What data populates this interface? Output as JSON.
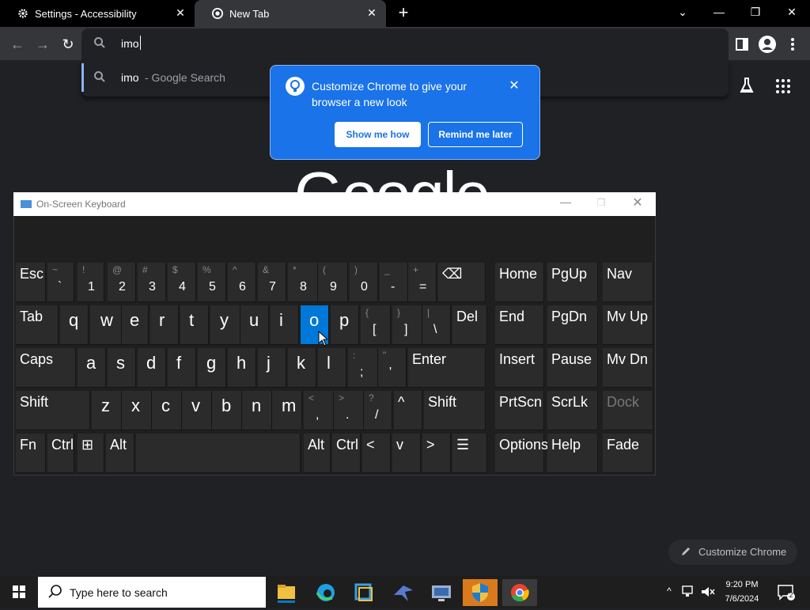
{
  "tabs": [
    {
      "title": "Settings - Accessibility",
      "icon": "gear-icon"
    },
    {
      "title": "New Tab",
      "icon": "chrome-icon"
    }
  ],
  "window_controls": {
    "dropdown": "⌄",
    "minimize": "—",
    "maximize": "❐",
    "close": "✕"
  },
  "omnibox": {
    "text": "imo"
  },
  "suggestion": {
    "query": "imo",
    "rest": " - Google Search"
  },
  "promo": {
    "text": "Customize Chrome to give your browser a new look",
    "show_label": "Show me how",
    "remind_label": "Remind me later"
  },
  "google_logo": "Google",
  "osk": {
    "title": "On-Screen Keyboard",
    "rows": [
      [
        {
          "label": "Esc",
          "kind": "lbl"
        },
        {
          "shift": "~",
          "main": "`"
        },
        {
          "shift": "!",
          "main": "1"
        },
        {
          "shift": "@",
          "main": "2"
        },
        {
          "shift": "#",
          "main": "3"
        },
        {
          "shift": "$",
          "main": "4"
        },
        {
          "shift": "%",
          "main": "5"
        },
        {
          "shift": "^",
          "main": "6"
        },
        {
          "shift": "&",
          "main": "7"
        },
        {
          "shift": "*",
          "main": "8"
        },
        {
          "shift": "(",
          "main": "9"
        },
        {
          "shift": ")",
          "main": "0"
        },
        {
          "shift": "_",
          "main": "-"
        },
        {
          "shift": "+",
          "main": "="
        },
        {
          "label": "⌫",
          "kind": "lbl"
        },
        {
          "label": "Home",
          "kind": "lbl"
        },
        {
          "label": "PgUp",
          "kind": "lbl"
        },
        {
          "label": "Nav",
          "kind": "lbl"
        }
      ],
      [
        {
          "label": "Tab",
          "kind": "lbl"
        },
        {
          "main": "q"
        },
        {
          "main": "w"
        },
        {
          "main": "e"
        },
        {
          "main": "r"
        },
        {
          "main": "t"
        },
        {
          "main": "y"
        },
        {
          "main": "u"
        },
        {
          "main": "i"
        },
        {
          "main": "o",
          "selected": true
        },
        {
          "main": "p"
        },
        {
          "shift": "{",
          "main": "["
        },
        {
          "shift": "}",
          "main": "]"
        },
        {
          "shift": "|",
          "main": "\\"
        },
        {
          "label": "Del",
          "kind": "lbl"
        },
        {
          "label": "End",
          "kind": "lbl"
        },
        {
          "label": "PgDn",
          "kind": "lbl"
        },
        {
          "label": "Mv Up",
          "kind": "lbl"
        }
      ],
      [
        {
          "label": "Caps",
          "kind": "lbl"
        },
        {
          "main": "a"
        },
        {
          "main": "s"
        },
        {
          "main": "d"
        },
        {
          "main": "f"
        },
        {
          "main": "g"
        },
        {
          "main": "h"
        },
        {
          "main": "j"
        },
        {
          "main": "k"
        },
        {
          "main": "l"
        },
        {
          "shift": ":",
          "main": ";"
        },
        {
          "shift": "\"",
          "main": "'"
        },
        {
          "label": "Enter",
          "kind": "lbl"
        },
        {
          "label": "Insert",
          "kind": "lbl"
        },
        {
          "label": "Pause",
          "kind": "lbl"
        },
        {
          "label": "Mv Dn",
          "kind": "lbl"
        }
      ],
      [
        {
          "label": "Shift",
          "kind": "lbl"
        },
        {
          "main": "z"
        },
        {
          "main": "x"
        },
        {
          "main": "c"
        },
        {
          "main": "v"
        },
        {
          "main": "b"
        },
        {
          "main": "n"
        },
        {
          "main": "m"
        },
        {
          "shift": "<",
          "main": ","
        },
        {
          "shift": ">",
          "main": "."
        },
        {
          "shift": "?",
          "main": "/"
        },
        {
          "label": "^",
          "kind": "lbl"
        },
        {
          "label": "Shift",
          "kind": "lbl"
        },
        {
          "label": "PrtScn",
          "kind": "lbl"
        },
        {
          "label": "ScrLk",
          "kind": "lbl"
        },
        {
          "label": "Dock",
          "kind": "lbl",
          "dim": true
        }
      ],
      [
        {
          "label": "Fn",
          "kind": "lbl"
        },
        {
          "label": "Ctrl",
          "kind": "lbl"
        },
        {
          "label": "⊞",
          "kind": "lbl"
        },
        {
          "label": "Alt",
          "kind": "lbl"
        },
        {
          "label": "",
          "kind": "lbl"
        },
        {
          "label": "Alt",
          "kind": "lbl"
        },
        {
          "label": "Ctrl",
          "kind": "lbl"
        },
        {
          "label": "<",
          "kind": "lbl"
        },
        {
          "label": "v",
          "kind": "lbl"
        },
        {
          "label": ">",
          "kind": "lbl"
        },
        {
          "label": "☰",
          "kind": "lbl"
        },
        {
          "label": "Options",
          "kind": "lbl"
        },
        {
          "label": "Help",
          "kind": "lbl"
        },
        {
          "label": "Fade",
          "kind": "lbl"
        }
      ]
    ]
  },
  "customize_chrome": "Customize Chrome",
  "taskbar": {
    "search_placeholder": "Type here to search",
    "time": "9:20 PM",
    "date": "7/6/2024",
    "notifications": "2"
  }
}
